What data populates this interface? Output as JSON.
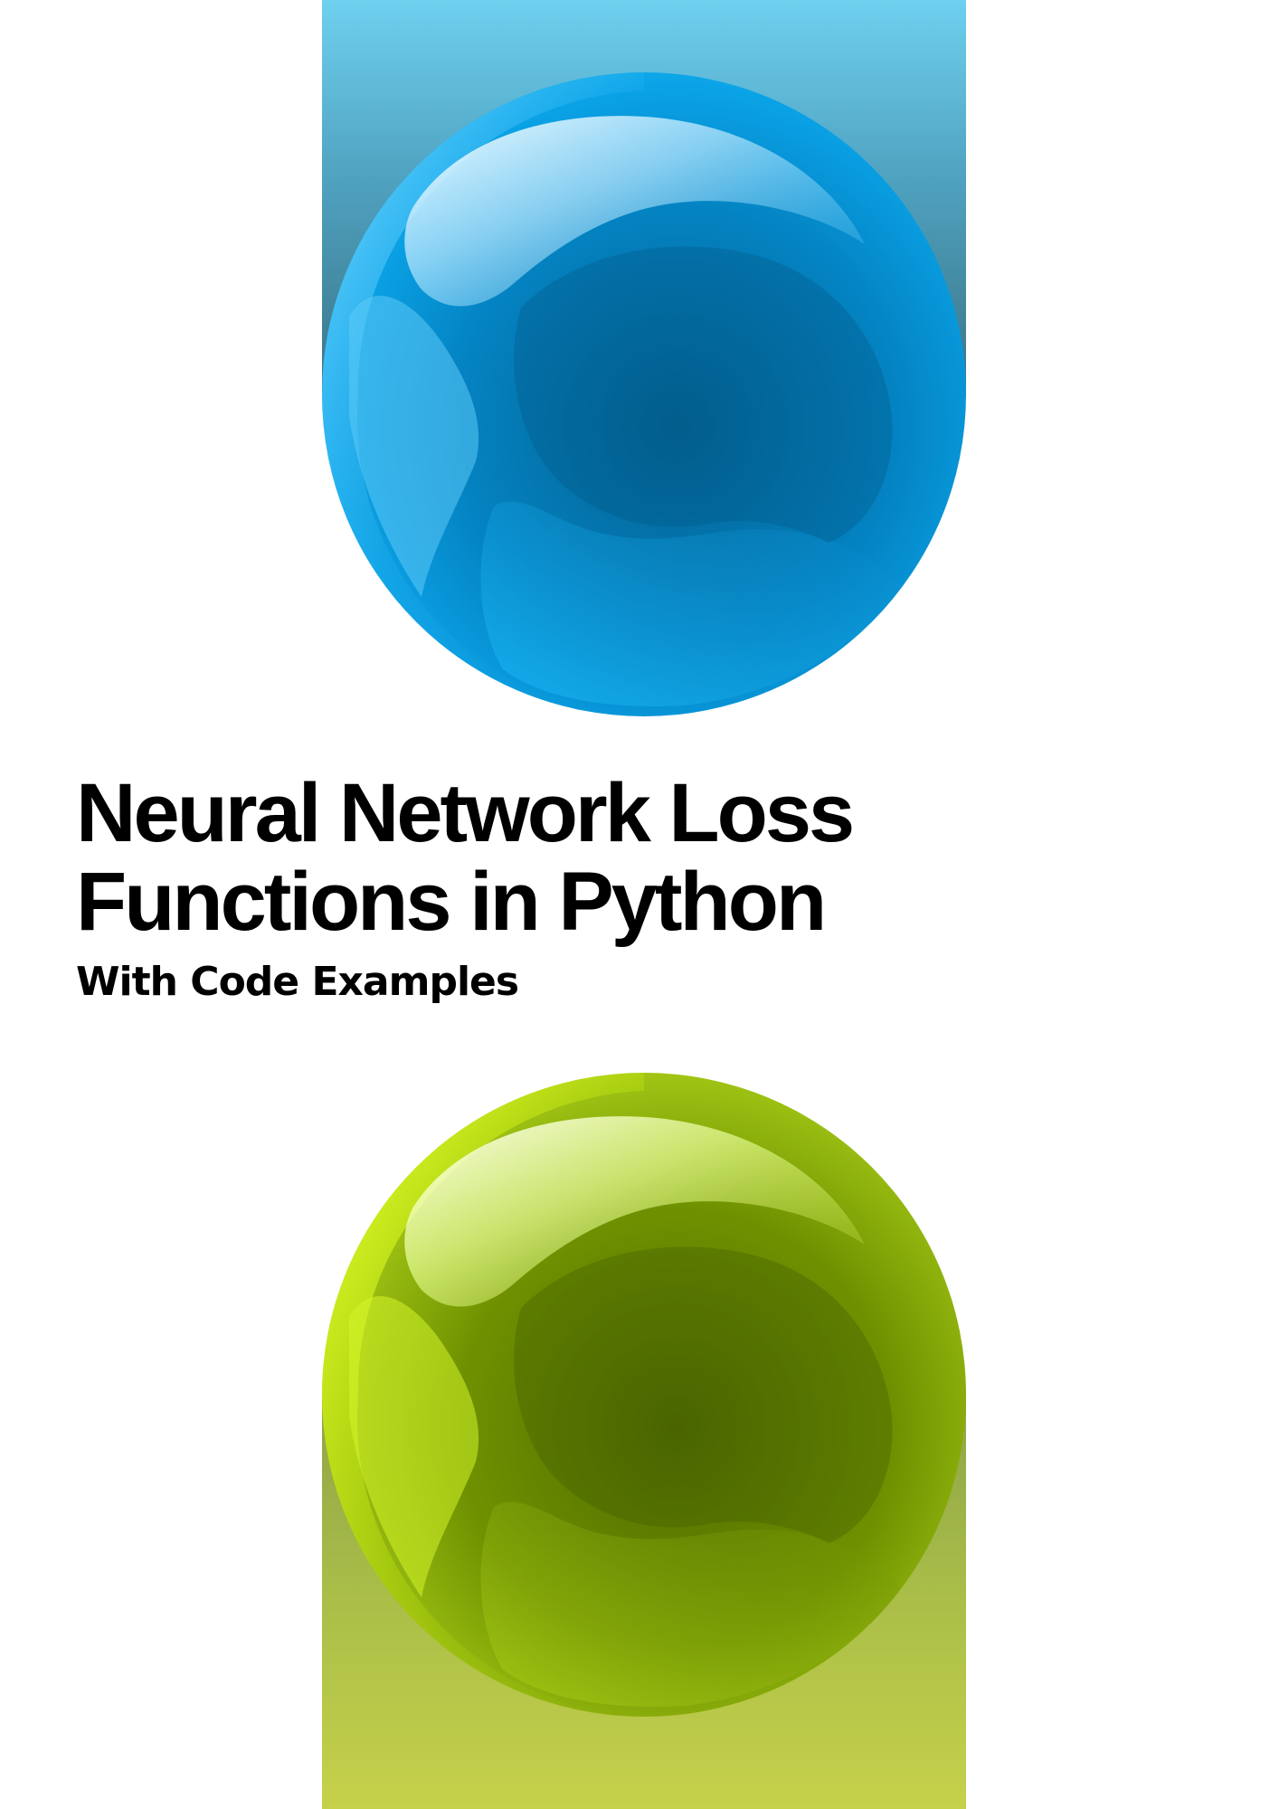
{
  "cover": {
    "title_line_1": "Neural Network Loss",
    "title_line_2": "Functions in Python",
    "subtitle": "With Code Examples"
  },
  "colors": {
    "background": "#ffffff",
    "text": "#000000",
    "top_strip": "#4fa2c0",
    "blue_sphere": "#0b9ae0",
    "bottom_strip": "#a7bc48",
    "green_sphere": "#9fc01a"
  },
  "decorations": {
    "top_sphere": "blue-glossy-sphere",
    "bottom_sphere": "green-glossy-sphere"
  }
}
